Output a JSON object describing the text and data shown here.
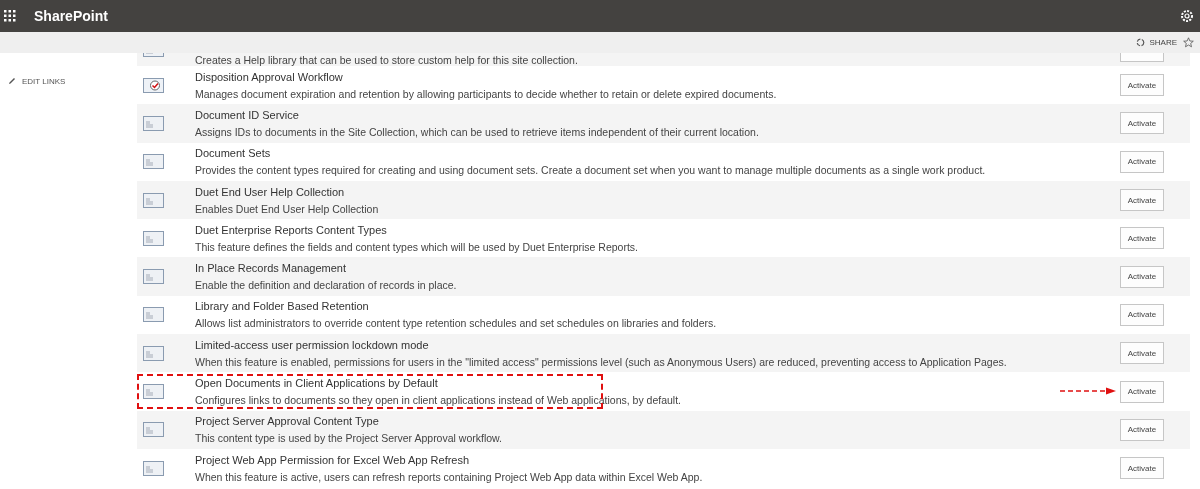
{
  "app_bar": {
    "title": "SharePoint"
  },
  "command_bar": {
    "share_label": "SHARE"
  },
  "sidebar": {
    "edit_links": "EDIT LINKS"
  },
  "features": [
    {
      "kind": "partial",
      "description": "Creates a Help library that can be used to store custom help for this site collection.",
      "highlighted": false
    },
    {
      "kind": "workflow",
      "title": "Disposition Approval Workflow",
      "description": "Manages document expiration and retention by allowing participants to decide whether to retain or delete expired documents.",
      "button": "Activate",
      "highlighted": false
    },
    {
      "kind": "standard",
      "title": "Document ID Service",
      "description": "Assigns IDs to documents in the Site Collection, which can be used to retrieve items independent of their current location.",
      "button": "Activate",
      "highlighted": false
    },
    {
      "kind": "standard",
      "title": "Document Sets",
      "description": "Provides the content types required for creating and using document sets. Create a document set when you want to manage multiple documents as a single work product.",
      "button": "Activate",
      "highlighted": false
    },
    {
      "kind": "standard",
      "title": "Duet End User Help Collection",
      "description": "Enables Duet End User Help Collection",
      "button": "Activate",
      "highlighted": false
    },
    {
      "kind": "standard",
      "title": "Duet Enterprise Reports Content Types",
      "description": "This feature defines the fields and content types which will be used by Duet Enterprise Reports.",
      "button": "Activate",
      "highlighted": false
    },
    {
      "kind": "standard",
      "title": "In Place Records Management",
      "description": "Enable the definition and declaration of records in place.",
      "button": "Activate",
      "highlighted": false
    },
    {
      "kind": "standard",
      "title": "Library and Folder Based Retention",
      "description": "Allows list administrators to override content type retention schedules and set schedules on libraries and folders.",
      "button": "Activate",
      "highlighted": false
    },
    {
      "kind": "standard",
      "title": "Limited-access user permission lockdown mode",
      "description": "When this feature is enabled, permissions for users in the \"limited access\" permissions level (such as Anonymous Users) are reduced, preventing access to Application Pages.",
      "button": "Activate",
      "highlighted": false
    },
    {
      "kind": "standard",
      "title": "Open Documents in Client Applications by Default",
      "description": "Configures links to documents so they open in client applications instead of Web applications, by default.",
      "button": "Activate",
      "highlighted": true
    },
    {
      "kind": "standard",
      "title": "Project Server Approval Content Type",
      "description": "This content type is used by the Project Server Approval workflow.",
      "button": "Activate",
      "highlighted": false
    },
    {
      "kind": "standard",
      "title": "Project Web App Permission for Excel Web App Refresh",
      "description": "When this feature is active, users can refresh reports containing Project Web App data within Excel Web App.",
      "button": "Activate",
      "highlighted": false
    }
  ]
}
